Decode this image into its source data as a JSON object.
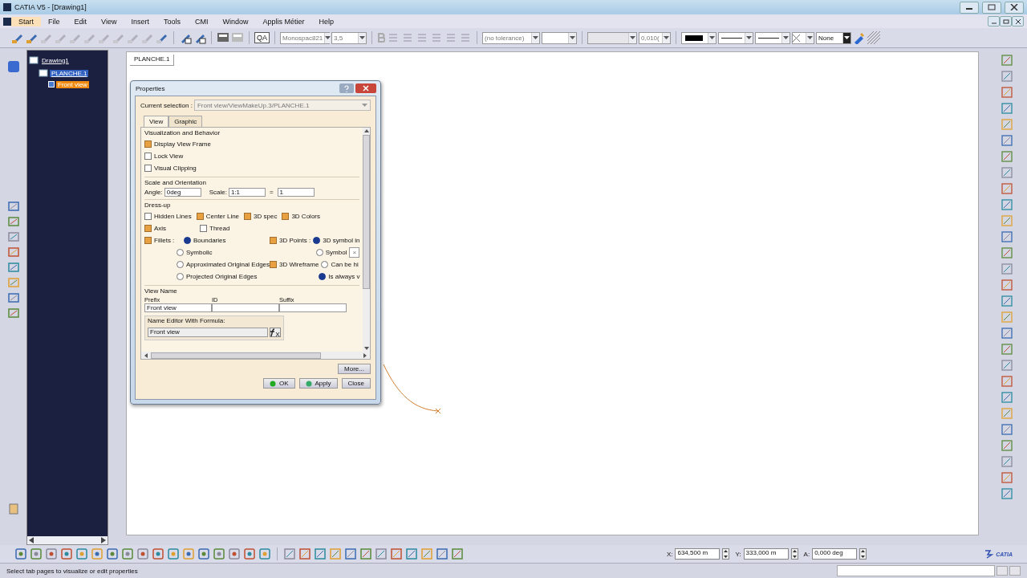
{
  "window": {
    "title": "CATIA V5 - [Drawing1]"
  },
  "menu": [
    {
      "label": "Start",
      "selected": true
    },
    {
      "label": "File",
      "selected": false
    },
    {
      "label": "Edit",
      "selected": false
    },
    {
      "label": "View",
      "selected": false
    },
    {
      "label": "Insert",
      "selected": false
    },
    {
      "label": "Tools",
      "selected": false
    },
    {
      "label": "CMI",
      "selected": false
    },
    {
      "label": "Window",
      "selected": false
    },
    {
      "label": "Applis Métier",
      "selected": false
    },
    {
      "label": "Help",
      "selected": false
    }
  ],
  "toolbar": {
    "qa": "QA",
    "font": "Monospac821",
    "size": "3,5",
    "tolerance": "(no tolerance)",
    "precision": "0,010(",
    "pattern": "None"
  },
  "tree": [
    {
      "label": "Drawing1",
      "active": false,
      "selected": false,
      "children": [
        {
          "label": "PLANCHE.1",
          "active": true,
          "selected": false,
          "children": [
            {
              "label": "Front view",
              "selected": true
            }
          ]
        }
      ]
    }
  ],
  "sheet_tab": "PLANCHE.1",
  "dialog": {
    "title": "Properties",
    "selection_label": "Current selection :",
    "selection": "Front view/ViewMakeUp.3/PLANCHE.1",
    "tabs": [
      {
        "label": "View",
        "selected": true
      },
      {
        "label": "Graphic",
        "selected": false
      }
    ],
    "visualization": {
      "title": "Visualization and Behavior",
      "options": [
        {
          "label": "Display View Frame",
          "checked": true
        },
        {
          "label": "Lock View",
          "checked": false
        },
        {
          "label": "Visual Clipping",
          "checked": false
        }
      ]
    },
    "scale": {
      "title": "Scale and Orientation",
      "angle_label": "Angle:",
      "angle": "0deg",
      "scale_label": "Scale:",
      "scale": "1:1",
      "equals": "=",
      "ratio": "1"
    },
    "dressup": {
      "title": "Dress-up",
      "row1": [
        {
          "label": "Hidden Lines",
          "checked": false
        },
        {
          "label": "Center Line",
          "checked": true
        },
        {
          "label": "3D spec",
          "checked": true
        },
        {
          "label": "3D Colors",
          "checked": true
        }
      ],
      "row2": [
        {
          "label": "Axis",
          "checked": true
        },
        {
          "label": "Thread",
          "checked": false
        }
      ],
      "fillets": {
        "label": "Fillets :",
        "checked": true,
        "options": [
          {
            "label": "Boundaries",
            "selected": true
          },
          {
            "label": "Symbolic",
            "selected": false
          },
          {
            "label": "Approximated Original Edges",
            "selected": false
          },
          {
            "label": "Projected Original Edges",
            "selected": false
          }
        ]
      },
      "points": {
        "label": "3D Points :",
        "checked": true,
        "options": [
          {
            "label": "3D symbol in",
            "selected": true
          },
          {
            "label": "Symbol",
            "selected": false
          }
        ],
        "symbol": "×"
      },
      "wireframe": {
        "label": "3D Wireframe",
        "checked": true,
        "options": [
          {
            "label": "Can be hi",
            "selected": false
          },
          {
            "label": "Is always v",
            "selected": true
          }
        ]
      }
    },
    "view_name": {
      "title": "View Name",
      "fields": [
        {
          "label": "Prefix",
          "value": "Front view"
        },
        {
          "label": "ID"
        },
        {
          "label": "Suffix"
        }
      ],
      "formula_label": "Name Editor With Formula:",
      "formula": "Front view"
    },
    "buttons": {
      "more": "More...",
      "ok": "OK",
      "apply": "Apply",
      "close": "Close"
    }
  },
  "coordinates": [
    {
      "label": "X:",
      "value": "634,500 m"
    },
    {
      "label": "Y:",
      "value": "333,000 m"
    },
    {
      "label": "A:",
      "value": "0,000 deg"
    }
  ],
  "brand": "CATIA",
  "status_bar": "Select tab pages to visualize or edit properties"
}
